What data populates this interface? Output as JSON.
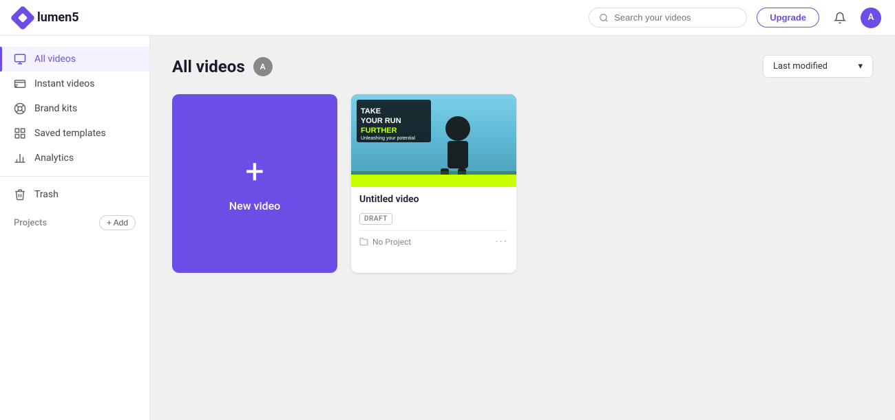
{
  "header": {
    "logo_text": "lumen5",
    "search_placeholder": "Search your videos",
    "upgrade_label": "Upgrade",
    "avatar_initial": "A"
  },
  "sidebar": {
    "items": [
      {
        "id": "all-videos",
        "label": "All videos",
        "active": true
      },
      {
        "id": "instant-videos",
        "label": "Instant videos",
        "active": false
      },
      {
        "id": "brand-kits",
        "label": "Brand kits",
        "active": false
      },
      {
        "id": "saved-templates",
        "label": "Saved templates",
        "active": false
      },
      {
        "id": "analytics",
        "label": "Analytics",
        "active": false
      },
      {
        "id": "trash",
        "label": "Trash",
        "active": false
      }
    ],
    "projects_label": "Projects",
    "add_label": "+ Add"
  },
  "main": {
    "title": "All videos",
    "title_avatar": "A",
    "sort_label": "Last modified",
    "sort_chevron": "▾",
    "new_video_label": "New video",
    "videos": [
      {
        "id": "untitled-video",
        "title": "Untitled video",
        "badge": "DRAFT",
        "project": "No Project",
        "thumbnail_line1": "TAKE YOUR RUN FURTHER",
        "thumbnail_sub": "Unleashing your potential"
      }
    ]
  }
}
